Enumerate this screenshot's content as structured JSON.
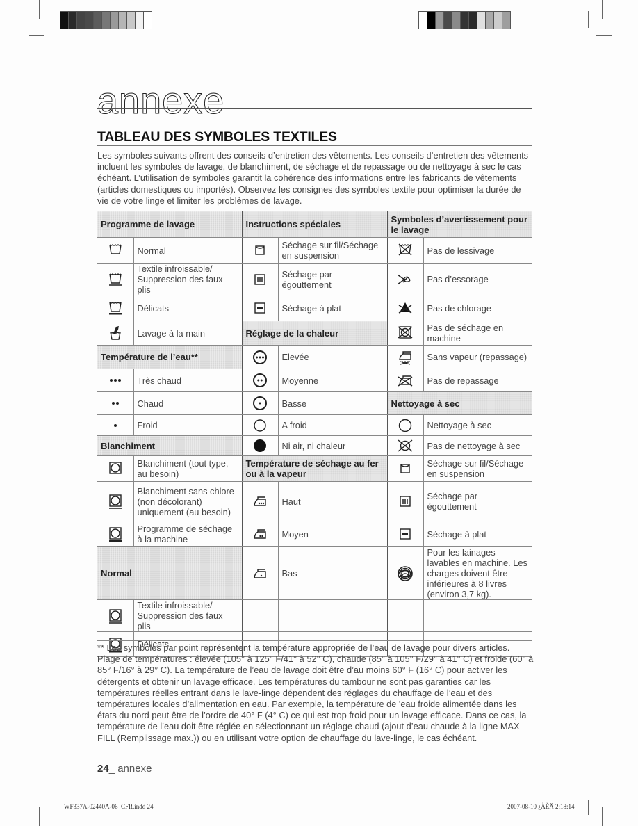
{
  "header": {
    "chapter_title": "annexe",
    "section_title": "TABLEAU DES SYMBOLES TEXTILES",
    "intro": "Les symboles suivants offrent des conseils d’entretien des vêtements. Les conseils d’entretien des vêtements incluent les symboles de lavage, de blanchiment, de séchage et de repassage ou de nettoyage à sec le cas échéant. L’utilisation de symboles garantit la cohérence des informations entre les fabricants de vêtements (articles domestiques ou importés). Observez les consignes des symboles textile pour optimiser la durée de vie de votre linge et limiter les problèmes de lavage."
  },
  "colors": {
    "header_fill": "#d8d8d8",
    "rule": "#888888",
    "text": "#444444"
  },
  "color_bars": {
    "left": [
      "#111111",
      "#2a2a2a",
      "#444444",
      "#4a4a4a",
      "#5c5c5c",
      "#777777",
      "#999999",
      "#b5b5b5",
      "#c8c8c8",
      "#f2f2f2",
      "#ffffff"
    ],
    "right": [
      "#ffffff",
      "#000000",
      "#9a9a9a",
      "#4a4a4a",
      "#8a8a8a",
      "#333333",
      "#2a2a2a",
      "#e0e0e0",
      "#aaaaaa",
      "#cccccc",
      "#9e9e9e"
    ]
  },
  "table": {
    "col1": {
      "header1": "Programme de lavage",
      "rows1": [
        {
          "icon": "washtub-normal-icon",
          "label": "Normal"
        },
        {
          "icon": "washtub-permanent-press-icon",
          "label": "Textile infroissable/ Suppression des faux plis"
        },
        {
          "icon": "washtub-delicate-icon",
          "label": "Délicats"
        },
        {
          "icon": "hand-wash-icon",
          "label": "Lavage à la main"
        }
      ],
      "header2": "Température de l’eau**",
      "rows2": [
        {
          "icon": "three-dots-icon",
          "label": "Très chaud"
        },
        {
          "icon": "two-dots-icon",
          "label": "Chaud"
        },
        {
          "icon": "one-dot-icon",
          "label": "Froid"
        }
      ],
      "header3": "Blanchiment",
      "rows3": [
        {
          "icon": "tumble-dry-normal-icon",
          "label": "Blanchiment (tout type, au besoin)"
        },
        {
          "icon": "tumble-dry-permanent-press-icon",
          "label": "Blanchiment sans chlore (non décolorant) uniquement (au besoin)"
        },
        {
          "icon": "tumble-dry-delicate-icon",
          "label": "Programme de séchage à la machine"
        }
      ],
      "header4": "Normal",
      "rows4": [
        {
          "icon": "tumble-dry-permanent-press-icon",
          "label": "Textile infroissable/ Suppression des faux plis"
        },
        {
          "icon": "tumble-dry-delicate-icon",
          "label": "Délicats"
        }
      ]
    },
    "col2": {
      "header1": "Instructions spéciales",
      "rows1": [
        {
          "icon": "line-dry-icon",
          "label": "Séchage sur fil/Séchage en suspension"
        },
        {
          "icon": "drip-dry-icon",
          "label": "Séchage par égouttement"
        },
        {
          "icon": "dry-flat-icon",
          "label": "Séchage à plat"
        }
      ],
      "header2": "Réglage de la chaleur",
      "rows2": [
        {
          "icon": "circle-three-dots-icon",
          "label": "Elevée"
        },
        {
          "icon": "circle-two-dots-icon",
          "label": "Moyenne"
        },
        {
          "icon": "circle-one-dot-icon",
          "label": "Basse"
        },
        {
          "icon": "circle-empty-icon",
          "label": "A froid"
        },
        {
          "icon": "circle-filled-icon",
          "label": "Ni air, ni chaleur"
        }
      ],
      "header3": "Température de séchage au fer ou à la vapeur",
      "rows3": [
        {
          "icon": "iron-high-icon",
          "label": "Haut"
        },
        {
          "icon": "iron-medium-icon",
          "label": "Moyen"
        },
        {
          "icon": "iron-low-icon",
          "label": "Bas"
        }
      ]
    },
    "col3": {
      "header1": "Symboles d’avertissement pour le lavage",
      "rows1": [
        {
          "icon": "do-not-wash-icon",
          "label": "Pas de lessivage"
        },
        {
          "icon": "do-not-wring-icon",
          "label": "Pas d’essorage"
        },
        {
          "icon": "do-not-bleach-icon",
          "label": "Pas de chlorage"
        },
        {
          "icon": "do-not-tumble-dry-icon",
          "label": "Pas de séchage en machine"
        },
        {
          "icon": "no-steam-icon",
          "label": "Sans vapeur (repassage)"
        },
        {
          "icon": "do-not-iron-icon",
          "label": "Pas de repassage"
        }
      ],
      "header2": "Nettoyage à sec",
      "rows2": [
        {
          "icon": "dry-clean-icon",
          "label": "Nettoyage à sec"
        },
        {
          "icon": "do-not-dry-clean-icon",
          "label": "Pas de nettoyage à sec"
        },
        {
          "icon": "line-dry-icon",
          "label": "Séchage sur fil/Séchage en suspension"
        },
        {
          "icon": "drip-dry-icon",
          "label": "Séchage par égouttement"
        },
        {
          "icon": "dry-flat-icon",
          "label": "Séchage à plat"
        },
        {
          "icon": "wool-icon",
          "label": "Pour les lainages lavables en machine. Les charges doivent être inférieures à 8 livres (environ 3,7 kg)."
        }
      ]
    }
  },
  "footnote": "** Les symboles par point représentent la température appropriée de l’eau de lavage pour divers articles. Plage de températures : élevée (105° à 125° F/41° à 52° C), chaude (85° à 105° F/29° à 41° C) et froide (60° à 85° F/16° à 29° C). La température de l’eau de lavage doit être d’au moins 60° F (16° C) pour activer les détergents et obtenir un lavage efficace. Les températures du tambour ne sont pas garanties car les températures réelles entrant dans le lave-linge dépendent des réglages du chauffage de l’eau et des températures locales d’alimentation en eau. Par exemple, la température de 'eau froide alimentée dans les états du nord peut être de l’ordre de 40° F (4° C) ce qui est trop froid pour un lavage efficace. Dans ce cas, la température de l’eau doit être réglée en sélectionnant un réglage chaud (ajout d’eau chaude à la ligne MAX FILL (Remplissage max.)) ou en utilisant votre option de chauffage du lave-linge, le cas échéant.",
  "footer": {
    "page_number": "24",
    "page_label": "_ annexe",
    "slug_left": "WF337A-02440A-06_CFR.indd   24",
    "slug_right": "2007-08-10   ¿ÀÈÄ 2:18:14"
  }
}
